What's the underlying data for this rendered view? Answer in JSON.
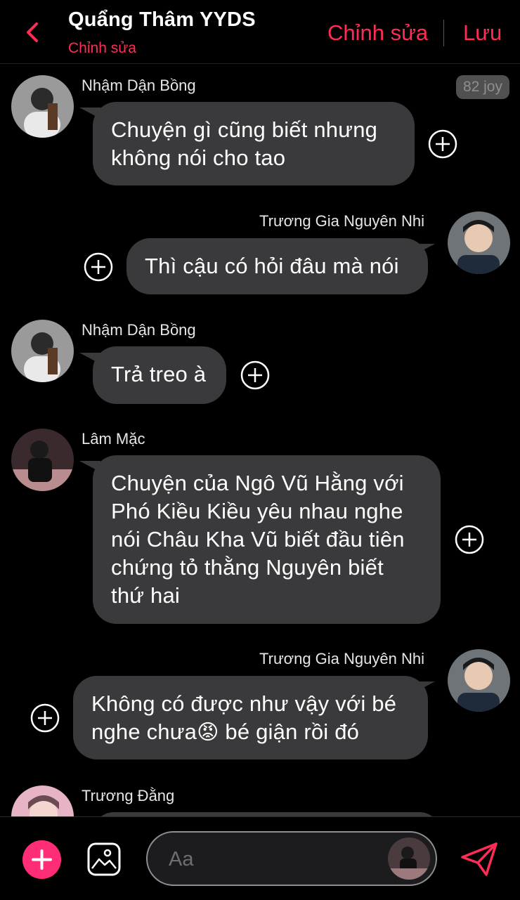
{
  "header": {
    "title": "Quẩng Thâm YYDS",
    "subtitle": "Chỉnh sửa",
    "edit_label": "Chỉnh sửa",
    "save_label": "Lưu"
  },
  "badge": "82 joy",
  "messages": [
    {
      "sender": "Nhậm Dận Bồng",
      "text": "Chuyện gì cũng biết nhưng\nkhông nói cho tao",
      "side": "left"
    },
    {
      "sender": "Trương Gia Nguyên Nhi",
      "text": "Thì cậu có hỏi đâu mà nói",
      "side": "right"
    },
    {
      "sender": "Nhậm Dận Bồng",
      "text": "Trả treo à",
      "side": "left"
    },
    {
      "sender": "Lâm Mặc",
      "text": "Chuyện của Ngô Vũ Hằng với\nPhó Kiều Kiều yêu nhau nghe\nnói Châu Kha Vũ biết đầu tiên\nchứng tỏ thằng Nguyên biết\nthứ hai",
      "side": "left"
    },
    {
      "sender": "Trương Gia Nguyên Nhi",
      "text_before": "Không có được như vậy với bé\nnghe chưa",
      "emoji": "😡",
      "text_after": " bé giận rồi đó",
      "side": "right"
    },
    {
      "sender": "Trương Đằng",
      "side": "left"
    }
  ],
  "composer": {
    "placeholder": "Aa"
  },
  "colors": {
    "accent": "#ff2d55",
    "add_button": "#ff2d78",
    "bubble": "#3a3a3c",
    "background": "#000000"
  }
}
